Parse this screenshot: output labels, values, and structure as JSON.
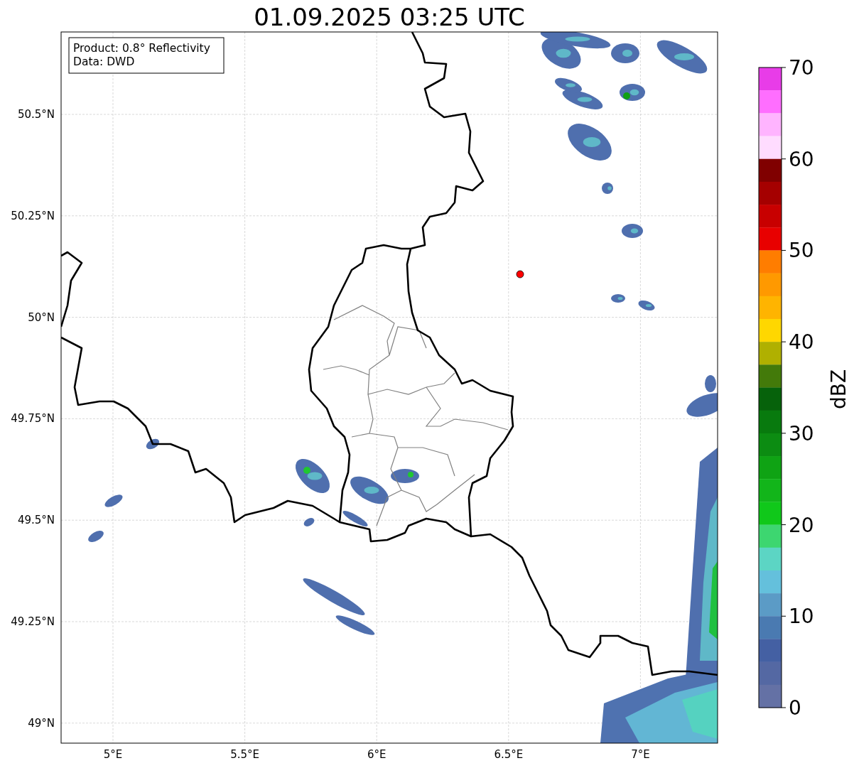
{
  "title": "01.09.2025 03:25 UTC",
  "annotation": [
    "Product: 0.8° Reflectivity",
    "Data: DWD"
  ],
  "lat_ticks": [
    "50.5°N",
    "50.25°N",
    "50°N",
    "49.75°N",
    "49.5°N",
    "49.25°N",
    "49°N"
  ],
  "lon_ticks": [
    "5°E",
    "5.5°E",
    "6°E",
    "6.5°E",
    "7°E"
  ],
  "marker": {
    "color": "#ff0000"
  },
  "colorbar": {
    "label": "dBZ",
    "ticks": [
      "70",
      "60",
      "50",
      "40",
      "30",
      "20",
      "10",
      "0"
    ],
    "segments": [
      {
        "color": "#e83ce8"
      },
      {
        "color": "#ff6eff"
      },
      {
        "color": "#ffb4ff"
      },
      {
        "color": "#ffdcff"
      },
      {
        "color": "#800000"
      },
      {
        "color": "#a50000"
      },
      {
        "color": "#c80000"
      },
      {
        "color": "#e80000"
      },
      {
        "color": "#ff7d00"
      },
      {
        "color": "#ff9900"
      },
      {
        "color": "#ffb400"
      },
      {
        "color": "#ffd700"
      },
      {
        "color": "#b0b000"
      },
      {
        "color": "#437a0a"
      },
      {
        "color": "#06620b"
      },
      {
        "color": "#087a0e"
      },
      {
        "color": "#0c8c12"
      },
      {
        "color": "#0fa314"
      },
      {
        "color": "#12b51a"
      },
      {
        "color": "#10c81a"
      },
      {
        "color": "#3dd670"
      },
      {
        "color": "#5cd5c4"
      },
      {
        "color": "#64c0dc"
      },
      {
        "color": "#5b9bc6"
      },
      {
        "color": "#4a7ab1"
      },
      {
        "color": "#4460a3"
      },
      {
        "color": "#5468a3"
      },
      {
        "color": "#6471a5"
      }
    ]
  }
}
